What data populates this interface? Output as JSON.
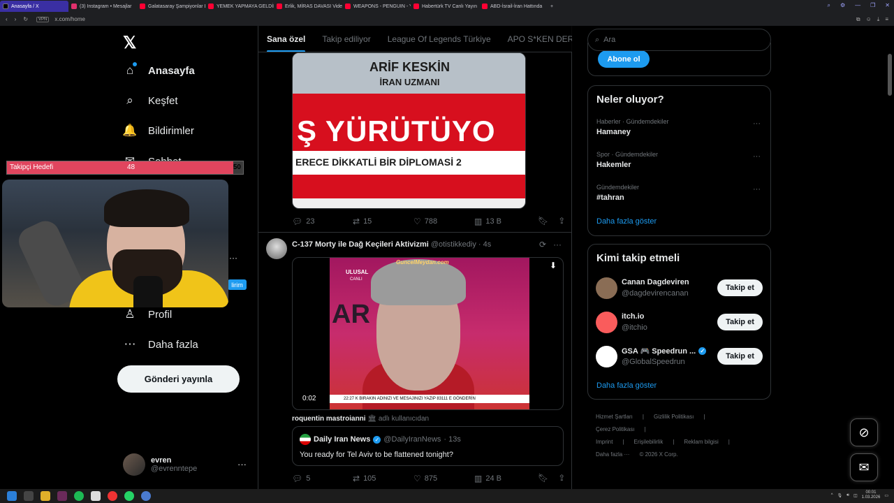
{
  "browser": {
    "tabs": [
      {
        "label": "Anasayfa / X",
        "active": true,
        "fav": "x"
      },
      {
        "label": "(3) Instagram • Mesajlar",
        "active": false,
        "fav": "ig"
      },
      {
        "label": "Galatasaray Şampiyonlar Ligi",
        "active": false,
        "fav": "yt"
      },
      {
        "label": "YEMEK YAPMAYA GELDİM",
        "active": false,
        "fav": "yt"
      },
      {
        "label": "Erlik, MİRAS DAVASI Video",
        "active": false,
        "fav": "yt"
      },
      {
        "label": "WEAPONS - PENGUIN - Y",
        "active": false,
        "fav": "yt"
      },
      {
        "label": "Habertürk TV Canlı Yayın",
        "active": false,
        "fav": "yt"
      },
      {
        "label": "ABD-İsrail-İran Hattında",
        "active": false,
        "fav": "yt"
      }
    ],
    "vpn": "VPN",
    "url": "x.com/home"
  },
  "nav": {
    "items": [
      {
        "label": "Anasayfa",
        "icon": "home-icon",
        "glyph": "⌂",
        "bold": true
      },
      {
        "label": "Keşfet",
        "icon": "search-icon",
        "glyph": "⌕"
      },
      {
        "label": "Bildirimler",
        "icon": "bell-icon",
        "glyph": "🔔"
      },
      {
        "label": "Sohbet",
        "icon": "chat-icon",
        "glyph": "✉"
      },
      {
        "label": "Profil",
        "icon": "person-icon",
        "glyph": "♙"
      },
      {
        "label": "Daha fazla",
        "icon": "more-circle-icon",
        "glyph": "⋯"
      }
    ],
    "post_button": "Gönderi yayınla",
    "account": {
      "name": "evren",
      "handle": "@evrenntepe",
      "more": "···"
    },
    "hidden_more": "···",
    "hidden_badge": "lirim"
  },
  "overlay": {
    "goal_label": "Takipçi Hedefi",
    "goal_current": "48",
    "goal_max": "50",
    "goal_fraction": 0.96
  },
  "feed": {
    "tabs": [
      "Sana özel",
      "Takip ediliyor",
      "League Of Legends Türkiye",
      "APO S*KEN DERNEĞİ"
    ],
    "tweet1": {
      "media": {
        "name": "ARİF KESKİN",
        "title": "İRAN UZMANI",
        "headline": "Ş YÜRÜTÜYO",
        "strip": "ERECE DİKKATLİ BİR DİPLOMASİ",
        "strip_num": "2"
      },
      "replies": "23",
      "reposts": "15",
      "likes": "788",
      "views": "13 B"
    },
    "tweet2": {
      "name": "C-137 Morty ile Dağ Keçileri Aktivizmi",
      "handle": "@otistikkediy",
      "time": "· 4s",
      "media": {
        "ulusal": "ULUSAL",
        "canli": "CANLI",
        "ar": "AR",
        "watermark": "GuncelMeydan.com",
        "ticker": "K BIRAKIN ADINIZI VE MESAJINIZI YAZIP 83111 E GÖNDERİN",
        "clock": "22:27",
        "time": "0:02"
      },
      "social_name": "roquentin mastroianni",
      "social_suffix": "🏛 adlı kullanıcıdan",
      "quote": {
        "name": "Daily Iran News",
        "handle": "@DailyIranNews",
        "time": "· 13s",
        "text": "You ready for Tel Aviv to be flattened tonight?"
      },
      "replies": "5",
      "reposts": "105",
      "likes": "875",
      "views": "24 B"
    }
  },
  "right": {
    "search_placeholder": "Ara",
    "subscribe_button": "Abone ol",
    "trends_title": "Neler oluyor?",
    "trends": [
      {
        "meta": "Haberler · Gündemdekiler",
        "name": "Hamaney"
      },
      {
        "meta": "Spor · Gündemdekiler",
        "name": "Hakemler"
      },
      {
        "meta": "Gündemdekiler",
        "name": "#tahran"
      }
    ],
    "trends_more": "Daha fazla göster",
    "who_title": "Kimi takip etmeli",
    "who": [
      {
        "name": "Canan Dagdeviren",
        "handle": "@dagdevirencanan",
        "color": "#8a6d55",
        "verified": false
      },
      {
        "name": "itch.io",
        "handle": "@itchio",
        "color": "#fa5c5c",
        "verified": false
      },
      {
        "name": "GSA 🎮 Speedrun ...",
        "handle": "@GlobalSpeedrun",
        "color": "#ffffff",
        "verified": true
      }
    ],
    "follow_label": "Takip et",
    "who_more": "Daha fazla göster",
    "footer": [
      "Hizmet Şartları",
      "|",
      "Gizlilik Politikası",
      "|",
      "Çerez Politikası",
      "|",
      "Imprint",
      "|",
      "Erişilebilirlik",
      "|",
      "Reklam bilgisi",
      "|",
      "Daha fazla ···",
      "© 2026 X Corp."
    ]
  },
  "taskbar": {
    "time": "00:01",
    "date": "1.03.2026"
  },
  "colors": {
    "accent": "#1d9bf0",
    "border": "#2f3336",
    "muted": "#71767b"
  }
}
